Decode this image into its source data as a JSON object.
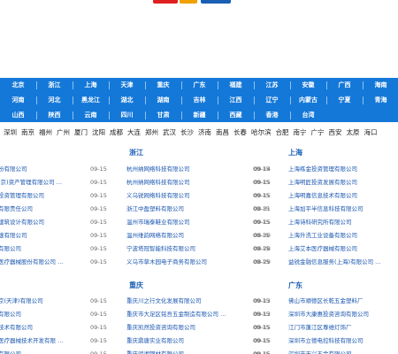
{
  "logo": {
    "colors": [
      "#e02020",
      "#f0a000",
      "#1a5fb4"
    ]
  },
  "nav": {
    "rows": [
      [
        "北京",
        "浙江",
        "上海",
        "天津",
        "重庆",
        "广东",
        "福建",
        "江苏",
        "安徽",
        "广西",
        "海南"
      ],
      [
        "河南",
        "河北",
        "黑龙江",
        "湖北",
        "湖南",
        "吉林",
        "江西",
        "辽宁",
        "内蒙古",
        "宁夏",
        "青海"
      ],
      [
        "山西",
        "陕西",
        "云南",
        "四川",
        "甘肃",
        "新疆",
        "西藏",
        "香港",
        "台湾"
      ]
    ]
  },
  "cities": [
    "深圳",
    "南京",
    "福州",
    "广州",
    "厦门",
    "沈阳",
    "成都",
    "大连",
    "郑州",
    "武汉",
    "长沙",
    "济南",
    "南昌",
    "长春",
    "哈尔滨",
    "合肥",
    "南宁",
    "广宁",
    "西安",
    "太原",
    "海口"
  ],
  "sections": {
    "zhejiang_title": "浙江",
    "shanghai_title": "上海",
    "chongqing_title": "重庆",
    "guangdong_title": "广东"
  },
  "lists": {
    "left_top": [
      {
        "name": "份有限公司",
        "date": "09-15"
      },
      {
        "name": "(京)资产管理有限公司 …",
        "date": "09-15"
      },
      {
        "name": "投资管理有限公司",
        "date": "09-15"
      },
      {
        "name": "有限责任公司",
        "date": "09-15"
      },
      {
        "name": "建筑设计有限公司",
        "date": "09-15"
      },
      {
        "name": "速有限公司",
        "date": "09-15"
      },
      {
        "name": "有限公司",
        "date": "09-15"
      },
      {
        "name": "医疗器械股份有限公司 …",
        "date": "09-15"
      }
    ],
    "zhejiang": [
      {
        "name": "杭州纳网络科技有限公司",
        "date": "09-14"
      },
      {
        "name": "杭州纳网络科技有限公司",
        "date": "09-15"
      },
      {
        "name": "义乌锐网络科技有限公司",
        "date": "09-15"
      },
      {
        "name": "浙江中盈塑料有限公司",
        "date": "08-31"
      },
      {
        "name": "温州市瑞泰鞋业有限公司",
        "date": "09-15"
      },
      {
        "name": "温州维韵网络有限公司",
        "date": "08-30"
      },
      {
        "name": "宁波塔冠智能科技有限公司",
        "date": "08-28"
      },
      {
        "name": "义乌市草木园电子商务有限公司",
        "date": "08-29"
      }
    ],
    "shanghai": [
      {
        "name": "上海练金投资管理有限公司",
        "date": "09-15"
      },
      {
        "name": "上海明匠投资发展有限公司",
        "date": "09-15"
      },
      {
        "name": "上海明嘉信息技术有限公司",
        "date": "09-15"
      },
      {
        "name": "上海加平半信息科技有限公司",
        "date": "09-15"
      },
      {
        "name": "上海诗科研究所有限公司",
        "date": "09-15"
      },
      {
        "name": "上海升洗工业设备有限公司",
        "date": "09-15"
      },
      {
        "name": "上海艾本医疗器械有限公司",
        "date": "09-15"
      },
      {
        "name": "益锐金融信息服务(上海)有限公司 …",
        "date": "09-15"
      }
    ],
    "left_bottom": [
      {
        "name": "京(天津)有限公司",
        "date": "09-15"
      },
      {
        "name": "有限公司",
        "date": "09-15"
      },
      {
        "name": "技术有限公司",
        "date": "09-15"
      },
      {
        "name": "医疗器械技术开发有限 …",
        "date": "09-15"
      },
      {
        "name": "有限公司",
        "date": "09-15"
      }
    ],
    "chongqing": [
      {
        "name": "重庆川之行文化发展有限公司",
        "date": "09-13"
      },
      {
        "name": "重庆市大足区铭吾五金制造有限公司 …",
        "date": "09-13"
      },
      {
        "name": "重庆凯然投资咨询有限公司",
        "date": "09-15"
      },
      {
        "name": "重庆鼎唐实业有限公司",
        "date": "09-15"
      },
      {
        "name": "重庆润湘钢材有限公司",
        "date": "09-15"
      }
    ],
    "guangdong": [
      {
        "name": "佛山市顺德区长乾五金塑料厂",
        "date": "09-15"
      },
      {
        "name": "深圳市大康惠投资咨询有限公司",
        "date": "09-15"
      },
      {
        "name": "江门市蓬江区尊维灯饰厂",
        "date": "09-15"
      },
      {
        "name": "深圳市立德电控科技有限公司",
        "date": "09-15"
      },
      {
        "name": "深圳市天兴五金有限公司",
        "date": "09-15"
      }
    ]
  }
}
